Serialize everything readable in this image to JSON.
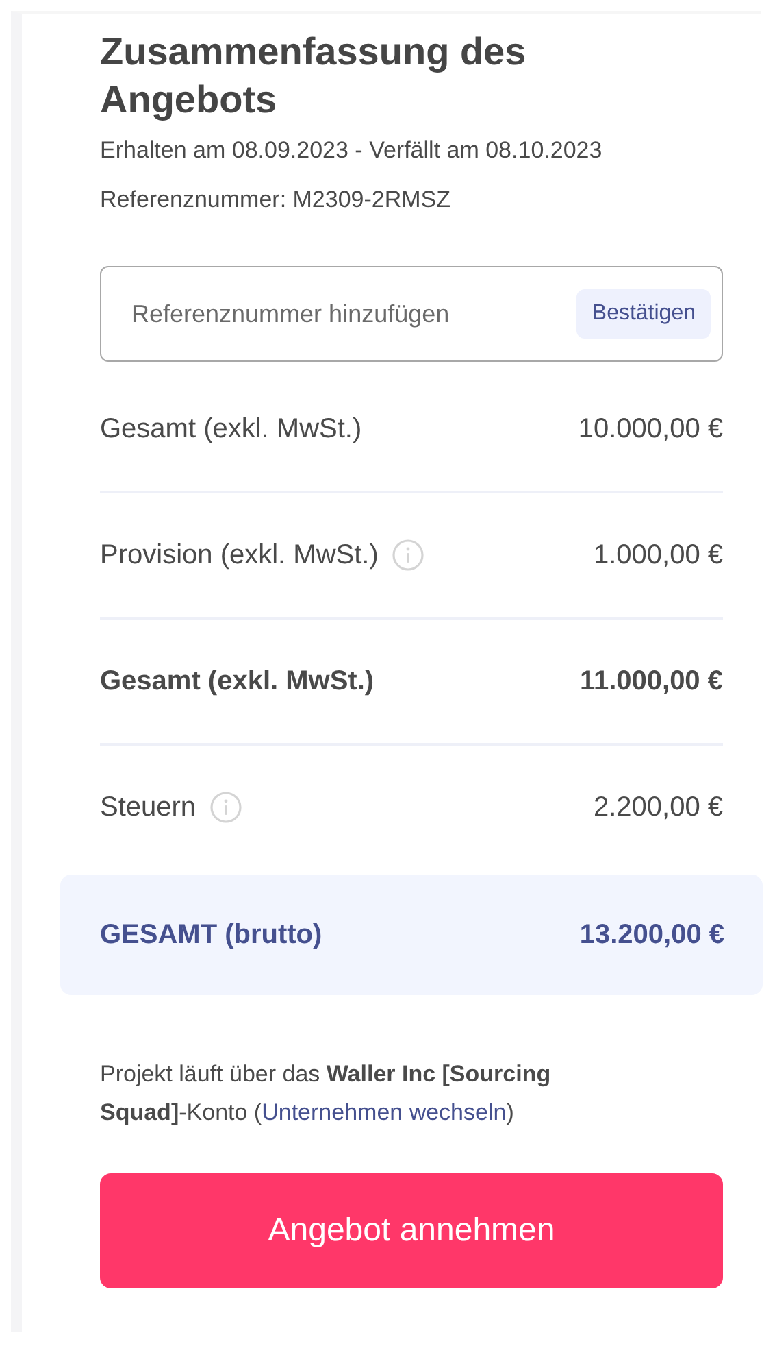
{
  "title": "Zusammenfassung des Angebots",
  "dates": "Erhalten am 08.09.2023 - Verfällt am 08.10.2023",
  "reference": "Referenznummer: M2309-2RMSZ",
  "reference_field": {
    "placeholder": "Referenznummer hinzufügen",
    "button": "Bestätigen"
  },
  "rows": [
    {
      "kind": "plain",
      "label": "Gesamt (exkl. MwSt.)",
      "value": "10.000,00 €",
      "info": false
    },
    {
      "kind": "plain",
      "label": "Provision (exkl. MwSt.)",
      "value": "1.000,00 €",
      "info": true
    },
    {
      "kind": "bold",
      "label": "Gesamt (exkl. MwSt.)",
      "value": "11.000,00 €",
      "info": false
    },
    {
      "kind": "plain",
      "label": "Steuern",
      "value": "2.200,00 €",
      "info": true
    },
    {
      "kind": "total",
      "label": "GESAMT (brutto)",
      "value": "13.200,00 €",
      "info": false
    }
  ],
  "note": {
    "text": "Projekt läuft über das **Waller Inc [Sourcing Squad]**-Konto (",
    "link": "Unternehmen wechseln",
    "text_after": ")"
  },
  "accept_button": "Angebot annehmen"
}
